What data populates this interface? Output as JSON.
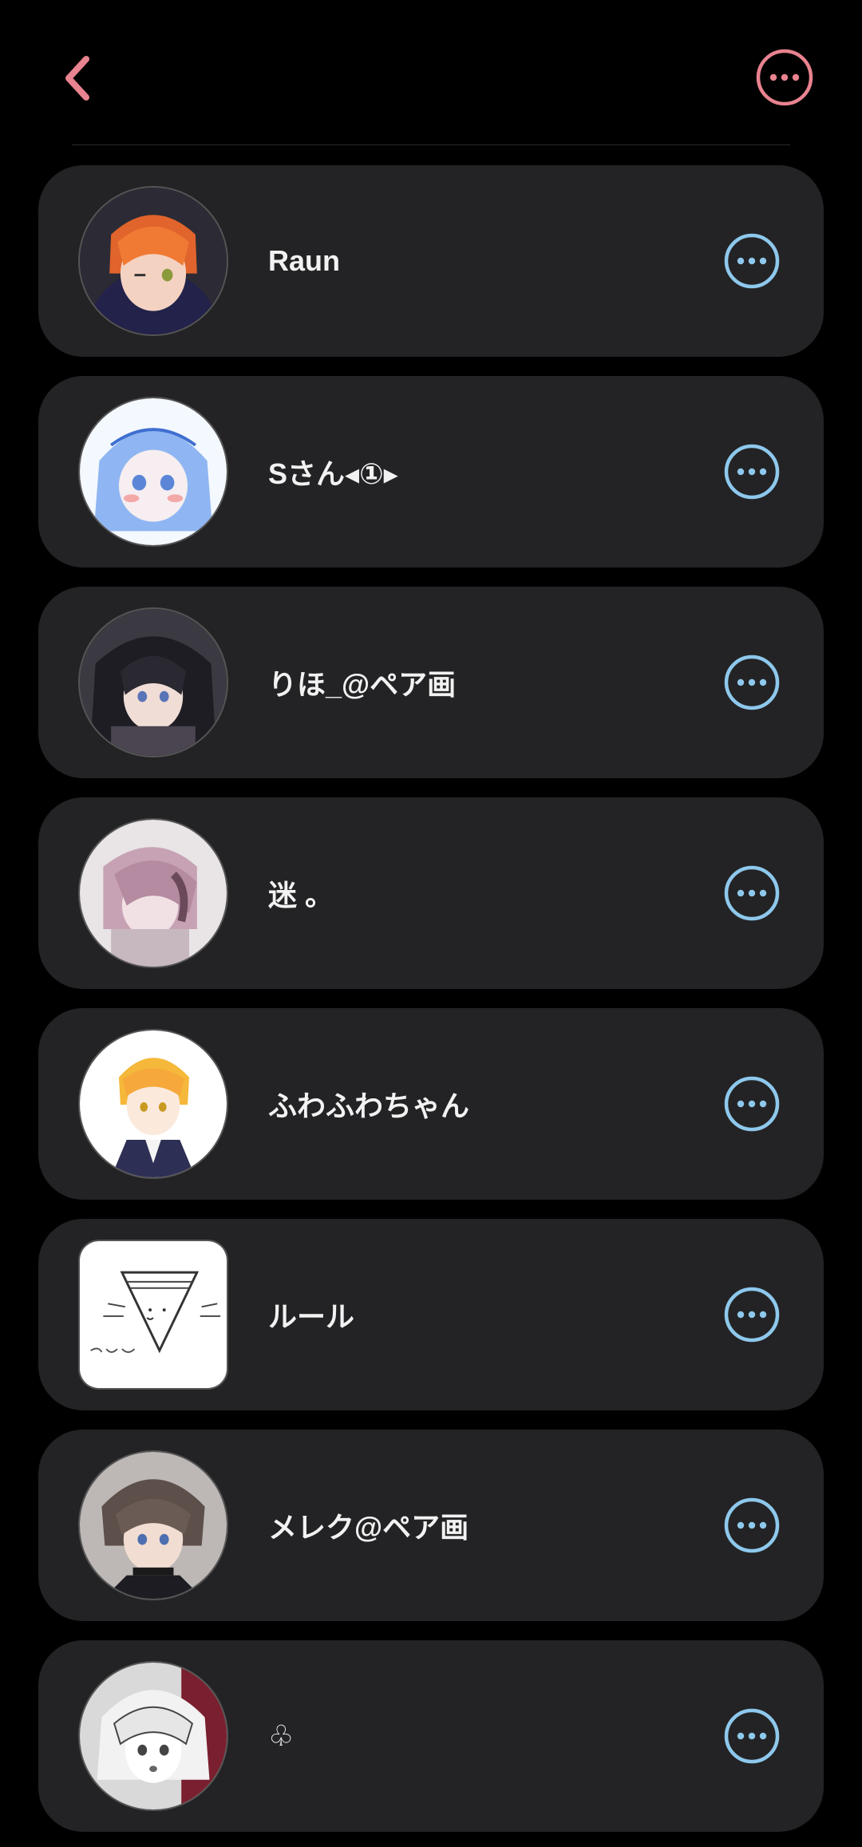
{
  "colors": {
    "background": "#000000",
    "card": "#232325",
    "accent_pink": "#e8838f",
    "accent_blue": "#8ec8ec",
    "text": "#f2f2f2"
  },
  "header": {
    "back_icon": "chevron-left-icon",
    "more_icon": "more-horizontal-circle-icon"
  },
  "members": [
    {
      "name": "Raun",
      "avatar_shape": "circle",
      "more_icon": "more-horizontal-circle-icon"
    },
    {
      "name": "Sさん◂①▸",
      "avatar_shape": "circle",
      "more_icon": "more-horizontal-circle-icon"
    },
    {
      "name": "りほ_@ペア画",
      "avatar_shape": "circle",
      "more_icon": "more-horizontal-circle-icon"
    },
    {
      "name": "迷 。",
      "avatar_shape": "circle",
      "more_icon": "more-horizontal-circle-icon"
    },
    {
      "name": "ふわふわちゃん",
      "avatar_shape": "circle",
      "more_icon": "more-horizontal-circle-icon"
    },
    {
      "name": "ルール",
      "avatar_shape": "square",
      "more_icon": "more-horizontal-circle-icon"
    },
    {
      "name": "メレク@ペア画",
      "avatar_shape": "circle",
      "more_icon": "more-horizontal-circle-icon"
    },
    {
      "name": "♧",
      "avatar_shape": "circle",
      "more_icon": "more-horizontal-circle-icon"
    }
  ]
}
